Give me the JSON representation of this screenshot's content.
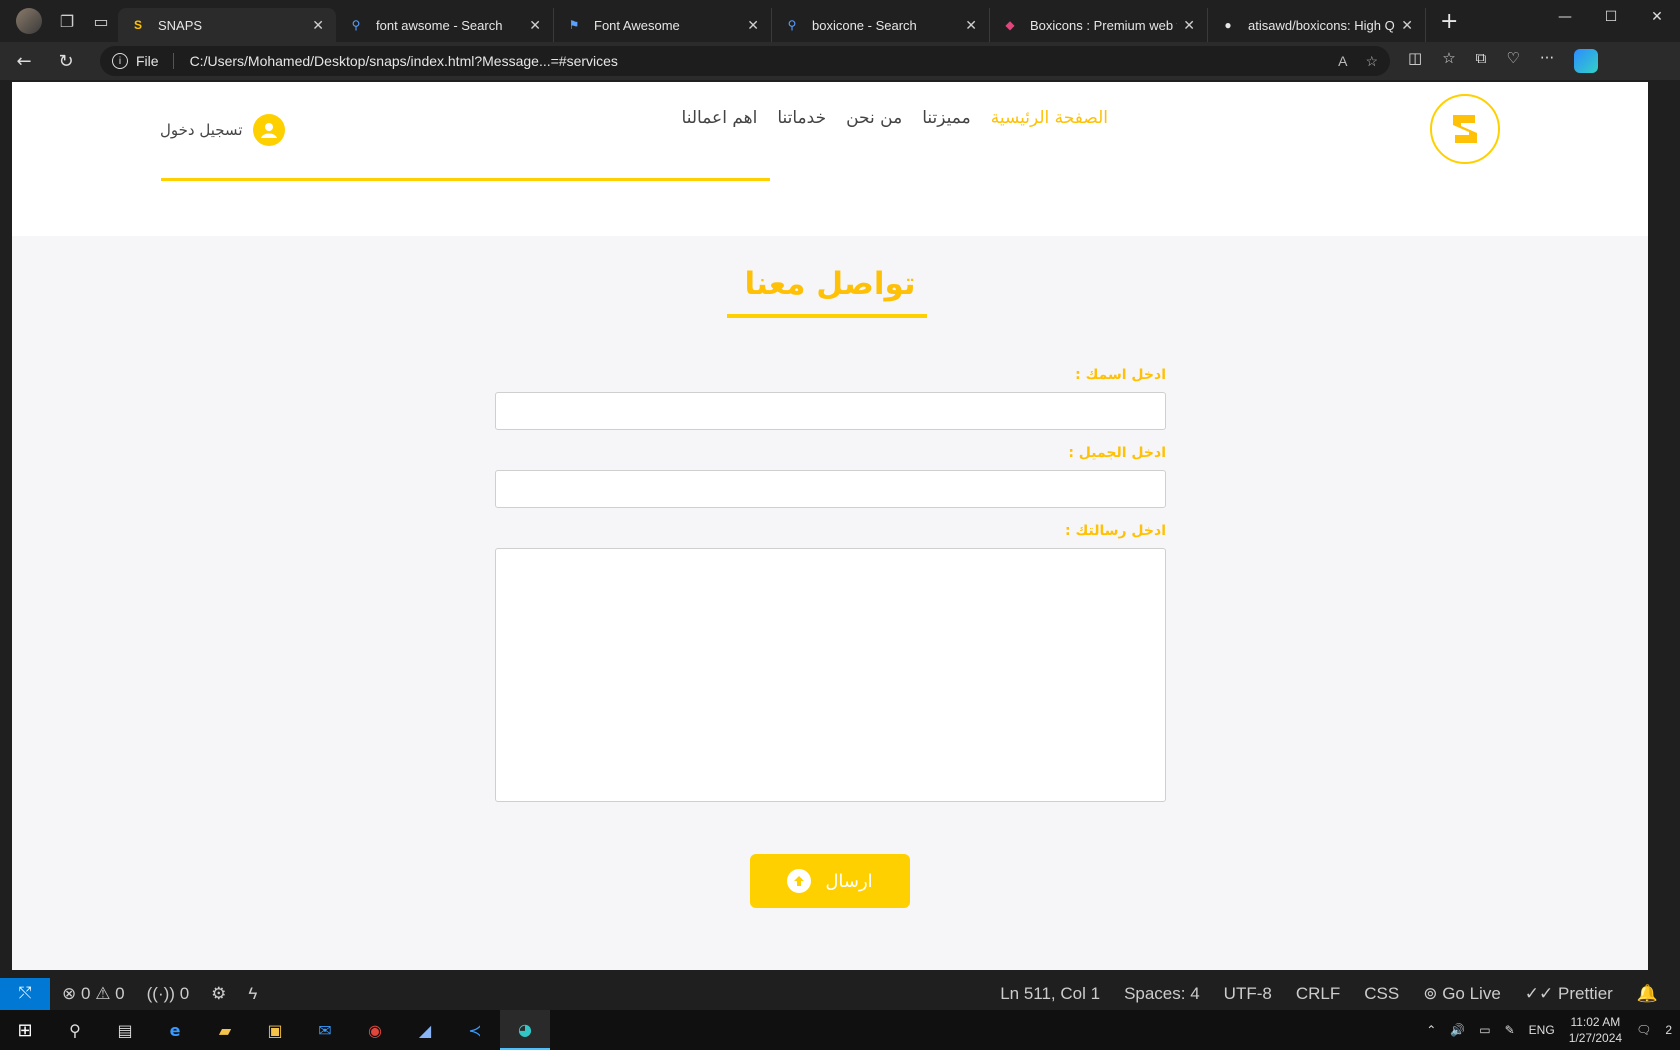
{
  "browser": {
    "tabs": [
      {
        "title": "SNAPS",
        "active": true,
        "icon": "snaps-logo-icon"
      },
      {
        "title": "font awsome - Search",
        "active": false,
        "icon": "search-icon"
      },
      {
        "title": "Font Awesome",
        "active": false,
        "icon": "flag-icon"
      },
      {
        "title": "boxicone - Search",
        "active": false,
        "icon": "search-icon"
      },
      {
        "title": "Boxicons : Premium web frien",
        "active": false,
        "icon": "boxicons-logo-icon"
      },
      {
        "title": "atisawd/boxicons: High Qual",
        "active": false,
        "icon": "github-icon"
      }
    ],
    "address": {
      "scheme": "File",
      "url": "C:/Users/Mohamed/Desktop/snaps/index.html?Message...=#services"
    }
  },
  "site": {
    "nav": [
      "الصفحة الرئيسية",
      "مميزتنا",
      "من نحن",
      "خدماتنا",
      "اهم اعمالنا"
    ],
    "login": "تسجيل دخول",
    "accent_color": "#ffd000"
  },
  "contact": {
    "title": "تواصل معنا",
    "name_label": "ادخل اسمك :",
    "mobile_label": "ادخل الجميل :",
    "message_label": "ادخل رسالتك :",
    "send_label": "ارسال"
  },
  "status": {
    "errors": "0",
    "warnings": "0",
    "ports": "0",
    "position": "Ln 511, Col 1",
    "spaces": "Spaces: 4",
    "encoding": "UTF-8",
    "eol": "CRLF",
    "language": "CSS",
    "golive": "Go Live",
    "prettier": "Prettier"
  },
  "taskbar": {
    "language": "ENG",
    "time": "11:02 AM",
    "date": "1/27/2024",
    "notifications": "2"
  }
}
